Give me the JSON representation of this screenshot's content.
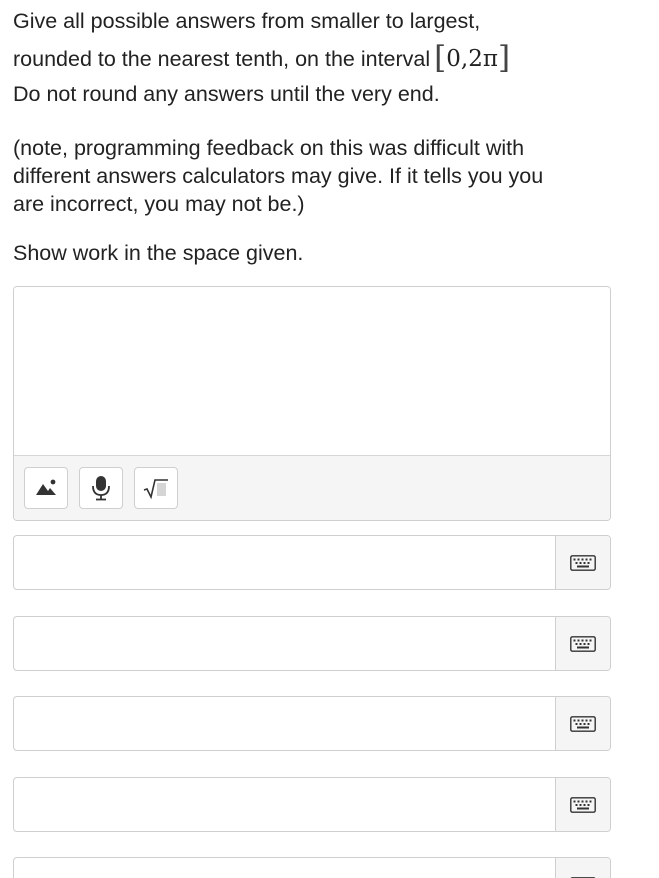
{
  "prompt": {
    "line1": "Give all possible answers from smaller to largest,",
    "line2": "rounded to the nearest tenth, on the interval",
    "interval_open": "[",
    "interval_body": "0,2π",
    "interval_close": "]",
    "line3": "Do not round any answers until the very end."
  },
  "note": {
    "line1": "(note, programming feedback on this was difficult with",
    "line2": "different answers calculators may give. If it tells you you",
    "line3": "are incorrect, you may not be.)"
  },
  "instructions": "Show work in the space given.",
  "work_area": {
    "value": "",
    "tools": [
      {
        "icon": "image-icon"
      },
      {
        "icon": "microphone-icon"
      },
      {
        "icon": "square-root-icon"
      }
    ]
  },
  "answers": [
    {
      "value": "",
      "icon": "keyboard-icon"
    },
    {
      "value": "",
      "icon": "keyboard-icon"
    },
    {
      "value": "",
      "icon": "keyboard-icon"
    },
    {
      "value": "",
      "icon": "keyboard-icon"
    },
    {
      "value": "",
      "icon": "keyboard-icon"
    }
  ],
  "colors": {
    "text": "#222222",
    "border": "#cfcfcf",
    "toolbar_bg": "#f5f5f5",
    "icon": "#333333"
  }
}
